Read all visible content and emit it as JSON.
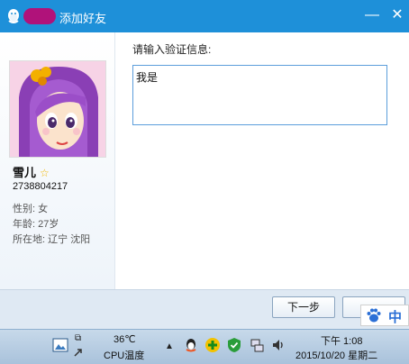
{
  "window": {
    "title": "添加好友",
    "minimize_glyph": "—",
    "close_glyph": "✕"
  },
  "profile": {
    "nickname": "雪儿",
    "qq_number": "2738804217",
    "gender": "性别: 女",
    "age": "年龄: 27岁",
    "location": "所在地: 辽宁  沈阳"
  },
  "form": {
    "prompt": "请输入验证信息:",
    "message_value": "我是"
  },
  "buttons": {
    "next_label": "下一步"
  },
  "ime": {
    "mode_label": "中"
  },
  "taskbar": {
    "cpu_temp": "36℃",
    "cpu_label": "CPU温度",
    "time": "下午 1:08",
    "date": "2015/10/20 星期二"
  },
  "colors": {
    "titlebar": "#1e90d9",
    "accent_border": "#5c9edb",
    "star": "#f1b600"
  }
}
